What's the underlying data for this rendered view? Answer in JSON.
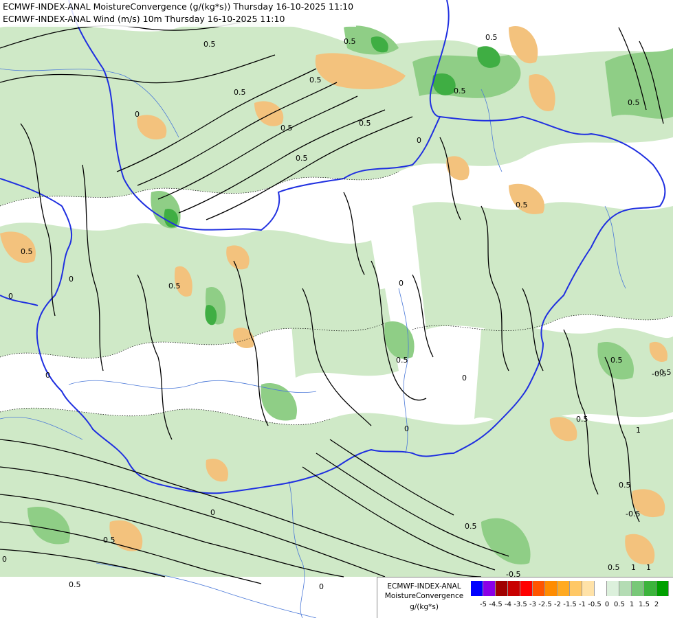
{
  "titles": {
    "line1": "ECMWF-INDEX-ANAL MoistureConvergence (g/(kg*s)) Thursday 16-10-2025 11:10",
    "line2": "ECMWF-INDEX-ANAL Wind (m/s) 10m Thursday 16-10-2025 11:10"
  },
  "legend": {
    "line1": "ECMWF-INDEX-ANAL",
    "line2": "MoistureConvergence",
    "line3": "g/(kg*s)",
    "colors": [
      "#0000ff",
      "#8a00e6",
      "#a00000",
      "#c80000",
      "#ff0000",
      "#ff5500",
      "#ff8c00",
      "#ffaa22",
      "#ffc866",
      "#ffe2a8",
      "#ffffff",
      "#dcf0dc",
      "#b4dcb4",
      "#78c878",
      "#3cb43c",
      "#00a000"
    ],
    "ticks": [
      "-5",
      "-4.5",
      "-4",
      "-3.5",
      "-3",
      "-2.5",
      "-2",
      "-1.5",
      "-1",
      "-0.5",
      "0",
      "0.5",
      "1",
      "1.5",
      "2"
    ]
  },
  "contour_labels": [
    "0.5",
    "0.5",
    "0.5",
    "0.5",
    "0.5",
    "0.5",
    "0.5",
    "0",
    "0",
    "0",
    "0",
    "0.5",
    "0.5",
    "0.5",
    "0.5",
    "0",
    "0.5",
    "0.5",
    "0",
    "0",
    "0.5",
    "0.5",
    "0",
    "0.5",
    "-0.5",
    "-0.5",
    "0.5",
    "0.5",
    "0",
    "0",
    "0",
    "-0.5",
    "-0.5",
    "0.5",
    "0.5",
    "1",
    "1",
    "0.5",
    "1"
  ],
  "colors": {
    "border": "#1f2fe0",
    "river": "#4a78d8",
    "streamline": "#000000",
    "green_light": "#cfe9c7",
    "green_mid": "#8fce86",
    "green_dark": "#3fae43",
    "orange": "#f3c27d"
  }
}
